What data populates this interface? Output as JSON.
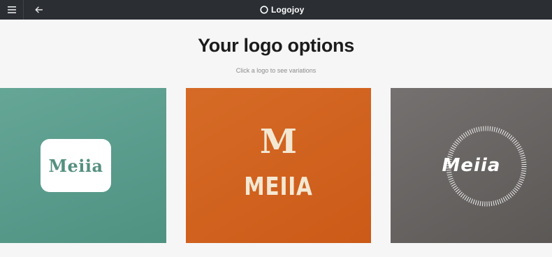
{
  "header": {
    "menu_icon": "hamburger-icon",
    "back_icon": "arrow-left-icon",
    "brand_name": "Logojoy",
    "brand_icon": "circle-logo-icon",
    "background_color": "#2b2f34"
  },
  "main": {
    "title": "Your logo options",
    "subtitle": "Click a logo to see variations"
  },
  "logos": [
    {
      "name": "Meiia",
      "background_color": "#5a9c8c",
      "style": "white rounded badge, teal serif wordmark"
    },
    {
      "monogram": "M",
      "name": "MEIIA",
      "background_color": "#d0621e",
      "style": "cream serif monogram over condensed wordmark"
    },
    {
      "name": "Meiia",
      "background_color": "#676463",
      "style": "italic white wordmark inside dotted circular ring"
    }
  ]
}
